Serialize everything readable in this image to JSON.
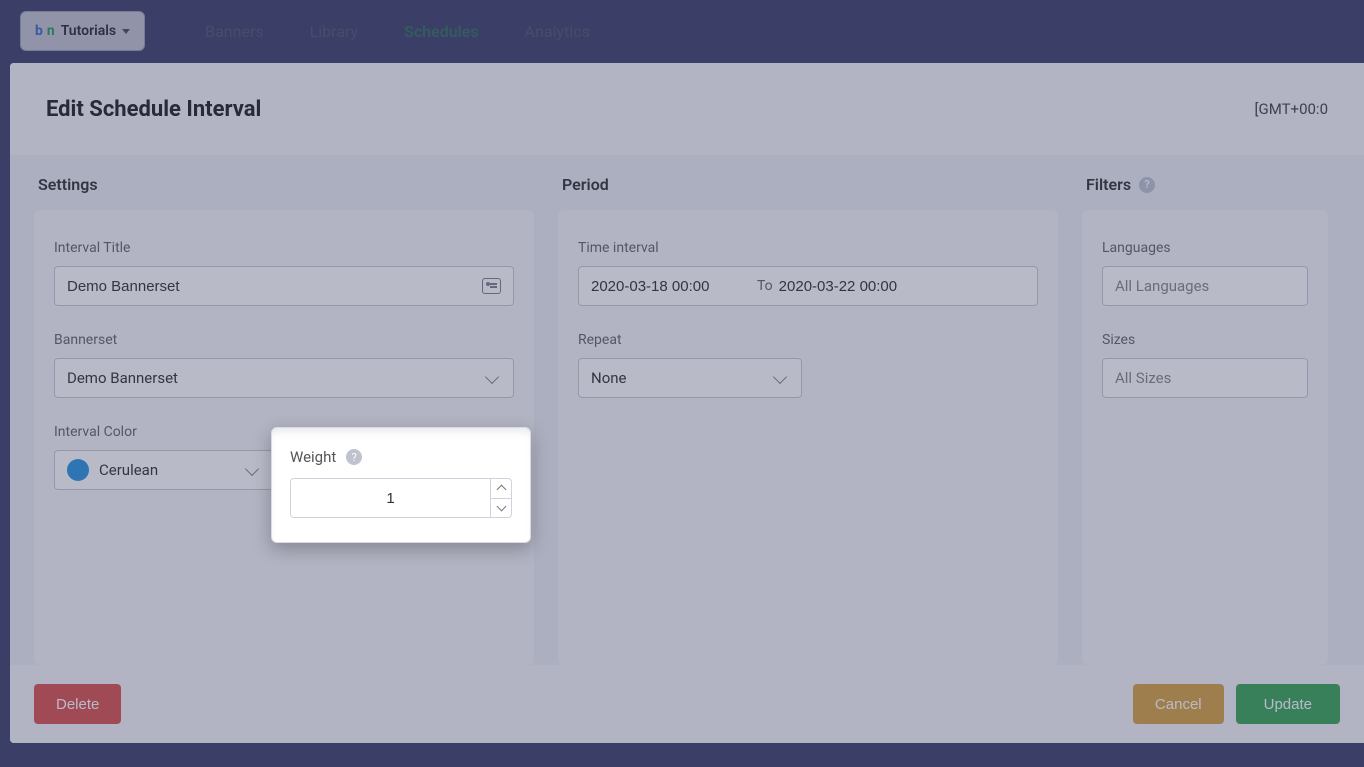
{
  "brand": {
    "prefix_b": "b",
    "prefix_n": "n",
    "label": "Tutorials"
  },
  "nav": {
    "items": [
      {
        "label": "Banners"
      },
      {
        "label": "Library"
      },
      {
        "label": "Schedules"
      },
      {
        "label": "Analytics"
      }
    ]
  },
  "modal": {
    "title": "Edit Schedule Interval",
    "timezone": "[GMT+00:0"
  },
  "settings": {
    "heading": "Settings",
    "interval_title_label": "Interval Title",
    "interval_title_value": "Demo Bannerset",
    "bannerset_label": "Bannerset",
    "bannerset_value": "Demo Bannerset",
    "interval_color_label": "Interval Color",
    "interval_color_value": "Cerulean",
    "interval_color_hex": "#2b95e0",
    "weight_label": "Weight",
    "weight_value": "1"
  },
  "period": {
    "heading": "Period",
    "time_interval_label": "Time interval",
    "from_value": "2020-03-18 00:00",
    "to_label": "To",
    "to_value": "2020-03-22 00:00",
    "repeat_label": "Repeat",
    "repeat_value": "None"
  },
  "filters": {
    "heading": "Filters",
    "languages_label": "Languages",
    "languages_placeholder": "All Languages",
    "sizes_label": "Sizes",
    "sizes_placeholder": "All Sizes"
  },
  "footer": {
    "delete": "Delete",
    "cancel": "Cancel",
    "update": "Update"
  }
}
